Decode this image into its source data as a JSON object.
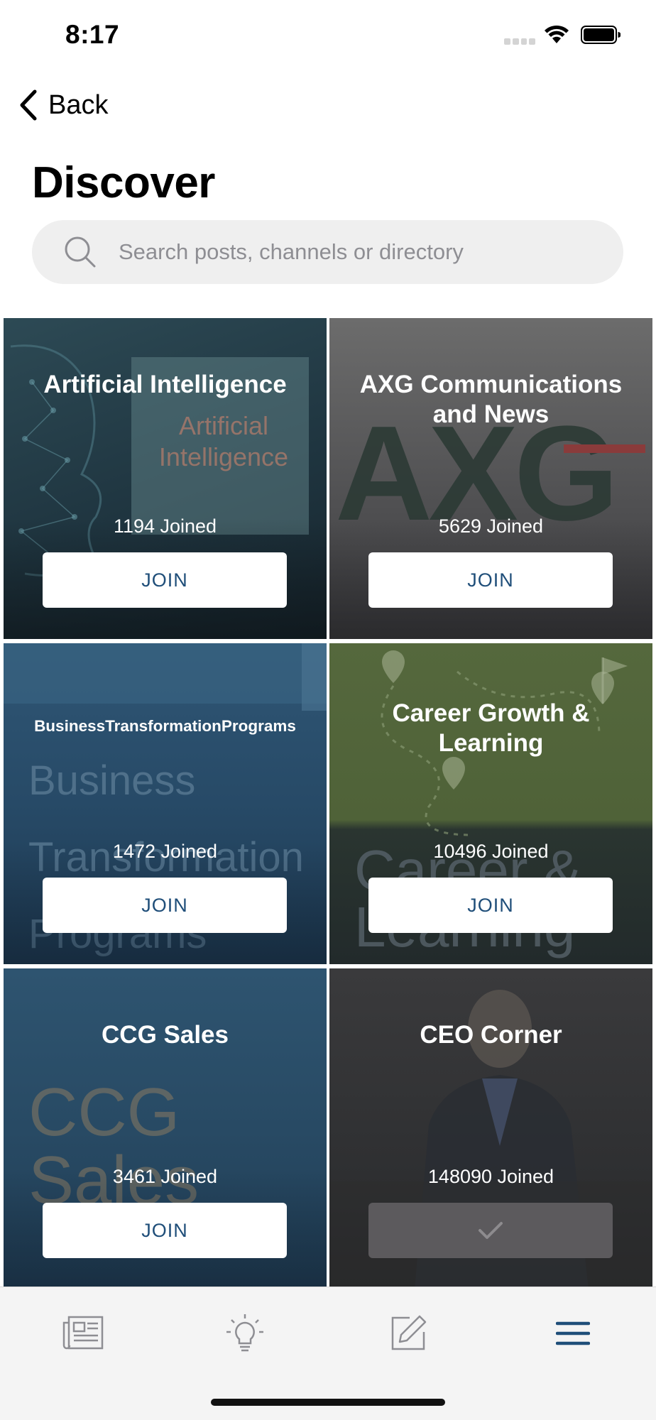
{
  "status_bar": {
    "time": "8:17"
  },
  "nav": {
    "back_label": "Back"
  },
  "page": {
    "title": "Discover"
  },
  "search": {
    "placeholder": "Search posts, channels or directory",
    "value": ""
  },
  "channels": [
    {
      "title": "Artificial Intelligence",
      "joined": "1194 Joined",
      "button_label": "JOIN",
      "is_joined": false,
      "image_text": "Artificial Intelligence"
    },
    {
      "title": "AXG Communications and News",
      "joined": "5629 Joined",
      "button_label": "JOIN",
      "is_joined": false,
      "image_text": "AXG"
    },
    {
      "title": "BusinessTransformationPrograms",
      "joined": "1472 Joined",
      "button_label": "JOIN",
      "is_joined": false,
      "image_text": "Business Transformation Programs"
    },
    {
      "title": "Career Growth & Learning",
      "joined": "10496 Joined",
      "button_label": "JOIN",
      "is_joined": false,
      "image_text": "Career & Learning"
    },
    {
      "title": "CCG Sales",
      "joined": "3461 Joined",
      "button_label": "JOIN",
      "is_joined": false,
      "image_text": "CCG Sales"
    },
    {
      "title": "CEO Corner",
      "joined": "148090 Joined",
      "button_label": "",
      "is_joined": true,
      "icon": "checkmark-icon"
    }
  ],
  "tab_bar": {
    "tabs": [
      {
        "icon": "newspaper-icon",
        "active": false
      },
      {
        "icon": "lightbulb-icon",
        "active": false
      },
      {
        "icon": "compose-icon",
        "active": false
      },
      {
        "icon": "menu-icon",
        "active": true
      }
    ]
  },
  "colors": {
    "accent": "#1f4e79",
    "tab_inactive": "#8e8e93",
    "join_text": "#1f4e79",
    "joined_button": "#5c5a5d",
    "search_bg": "#efefef"
  }
}
